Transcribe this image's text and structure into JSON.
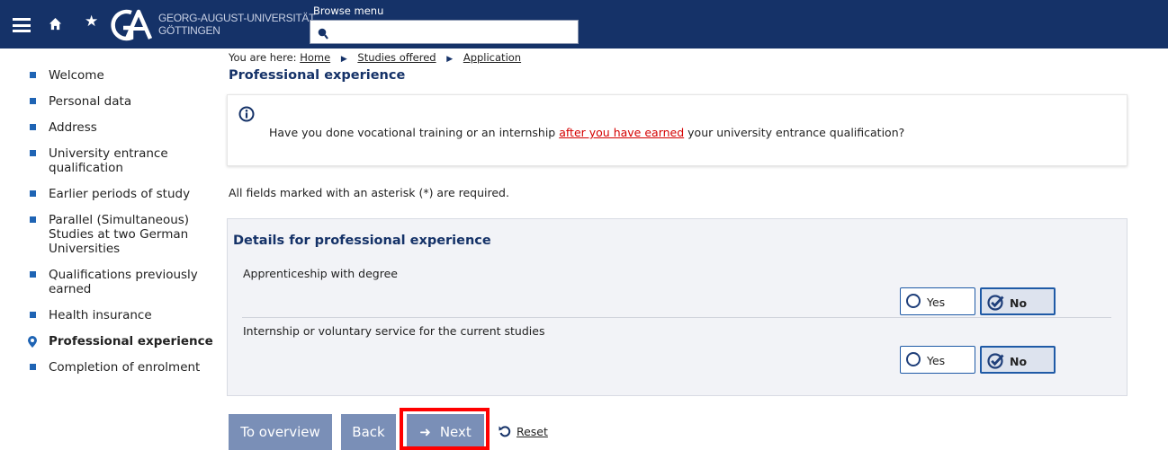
{
  "header": {
    "university_line1": "GEORG-AUGUST-UNIVERSITÄT",
    "university_line2": "GÖTTINGEN",
    "browse_menu_label": "Browse menu",
    "search_value": "",
    "icons": [
      "menu-icon",
      "home-icon",
      "star-icon",
      "university-logo",
      "search-icon"
    ]
  },
  "sidebar": {
    "items": [
      {
        "label": "Welcome",
        "active": false
      },
      {
        "label": "Personal data",
        "active": false
      },
      {
        "label": "Address",
        "active": false
      },
      {
        "label": "University entrance qualification",
        "active": false
      },
      {
        "label": "Earlier periods of study",
        "active": false
      },
      {
        "label": "Parallel (Simultaneous) Studies at two German Universities",
        "active": false
      },
      {
        "label": "Qualifications previously earned",
        "active": false
      },
      {
        "label": "Health insurance",
        "active": false
      },
      {
        "label": "Professional experience",
        "active": true
      },
      {
        "label": "Completion of enrolment",
        "active": false
      }
    ]
  },
  "breadcrumb": {
    "prefix": "You are here:",
    "items": [
      "Home",
      "Studies offered",
      "Application"
    ]
  },
  "page": {
    "title": "Professional experience",
    "info": {
      "before": "Have you done vocational training or an internship ",
      "highlight": "after you have earned",
      "after": " your university entrance qualification?"
    },
    "required_note": "All fields marked with an asterisk (*) are required."
  },
  "details": {
    "title": "Details for professional experience",
    "questions": [
      {
        "label": "Apprenticeship with degree",
        "yes": "Yes",
        "no": "No",
        "selected": "No"
      },
      {
        "label": "Internship or voluntary service for the current studies",
        "yes": "Yes",
        "no": "No",
        "selected": "No"
      }
    ]
  },
  "buttons": {
    "overview": "To overview",
    "back": "Back",
    "next": "Next",
    "reset": "Reset"
  },
  "colors": {
    "header_bg": "#153268",
    "accent": "#1f64b4",
    "button_bg": "#7a8fb7",
    "highlight_text": "#d50000",
    "focus_frame": "#ff0000"
  }
}
